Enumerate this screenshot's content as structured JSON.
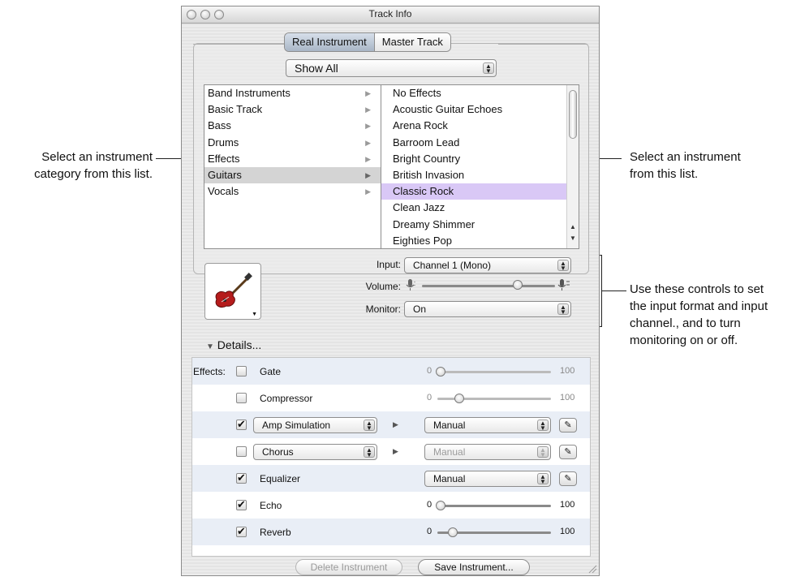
{
  "window": {
    "title": "Track Info"
  },
  "tabs": [
    {
      "label": "Real Instrument"
    },
    {
      "label": "Master Track"
    }
  ],
  "filter_popup": {
    "value": "Show All"
  },
  "categories": [
    {
      "label": "Band Instruments"
    },
    {
      "label": "Basic Track"
    },
    {
      "label": "Bass"
    },
    {
      "label": "Drums"
    },
    {
      "label": "Effects"
    },
    {
      "label": "Guitars",
      "selected": true
    },
    {
      "label": "Vocals"
    }
  ],
  "instruments": [
    {
      "label": "No Effects"
    },
    {
      "label": "Acoustic Guitar Echoes"
    },
    {
      "label": "Arena Rock"
    },
    {
      "label": "Barroom Lead"
    },
    {
      "label": "Bright Country"
    },
    {
      "label": "British Invasion"
    },
    {
      "label": "Classic Rock",
      "selected": true
    },
    {
      "label": "Clean Jazz"
    },
    {
      "label": "Dreamy Shimmer"
    },
    {
      "label": "Eighties Pop"
    }
  ],
  "controls": {
    "input_label": "Input:",
    "input_value": "Channel 1 (Mono)",
    "volume_label": "Volume:",
    "volume_level": 0.72,
    "monitor_label": "Monitor:",
    "monitor_value": "On"
  },
  "details": {
    "label": "Details..."
  },
  "effects": {
    "label": "Effects:",
    "gate": {
      "label": "Gate",
      "checked": false,
      "min": "0",
      "max": "100"
    },
    "compressor": {
      "label": "Compressor",
      "checked": false,
      "min": "0",
      "max": "100"
    },
    "amp_simulation": {
      "label": "Amp Simulation",
      "checked": true,
      "preset": "Manual"
    },
    "chorus": {
      "label": "Chorus",
      "checked": false,
      "preset": "Manual"
    },
    "equalizer": {
      "label": "Equalizer",
      "checked": true,
      "preset": "Manual"
    },
    "echo": {
      "label": "Echo",
      "checked": true,
      "min": "0",
      "max": "100"
    },
    "reverb": {
      "label": "Reverb",
      "checked": true,
      "min": "0",
      "max": "100"
    }
  },
  "buttons": {
    "delete": "Delete Instrument",
    "save": "Save Instrument..."
  },
  "callouts": {
    "category_line1": "Select an instrument",
    "category_line2": "category from this list.",
    "instrument_line1": "Select an instrument",
    "instrument_line2": "from this list.",
    "controls_line1": "Use these controls to set",
    "controls_line2": "the input format and input",
    "controls_line3": "channel., and to turn",
    "controls_line4": "monitoring on or off."
  }
}
